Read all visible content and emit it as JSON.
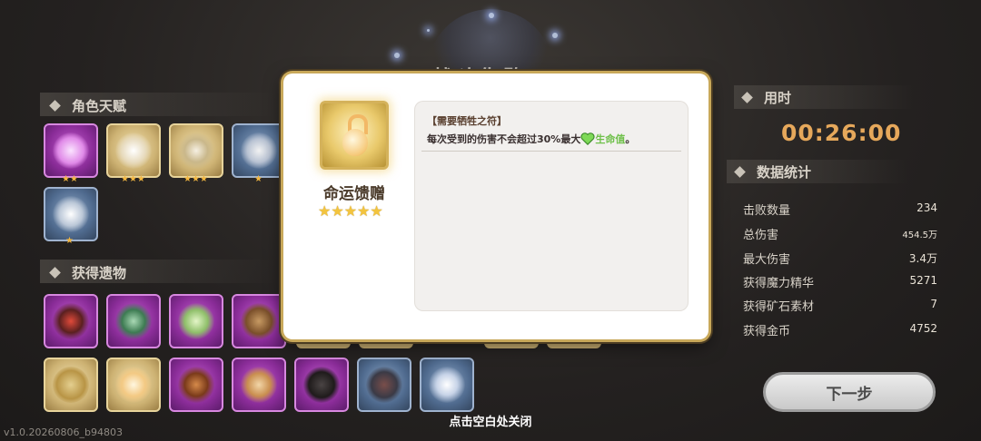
{
  "background_title": "战斗失败",
  "talents": {
    "title": "角色天赋",
    "tiles": [
      {
        "color": "purple",
        "icon": "flame-wing-icon",
        "stars": "★★"
      },
      {
        "color": "gold",
        "icon": "crescent-blade-icon",
        "stars": "★★★"
      },
      {
        "color": "gold",
        "icon": "cross-blades-icon",
        "stars": "★★★"
      },
      {
        "color": "blue",
        "icon": "bubble-beast-icon",
        "stars": "★"
      },
      {
        "color": "blue",
        "icon": "wind-slash-icon",
        "stars": "★"
      }
    ]
  },
  "relics": {
    "title": "获得遗物",
    "row1": [
      {
        "color": "purple",
        "icon": "horned-helmet-icon"
      },
      {
        "color": "purple",
        "icon": "green-hat-icon"
      },
      {
        "color": "purple",
        "icon": "cabbage-icon"
      },
      {
        "color": "purple",
        "icon": "coconut-icon"
      }
    ],
    "row2": [
      {
        "color": "gold",
        "icon": "gold-shield-icon"
      },
      {
        "color": "gold",
        "icon": "gourd-icon"
      },
      {
        "color": "purple",
        "icon": "chain-whip-icon"
      },
      {
        "color": "purple",
        "icon": "bread-icon"
      },
      {
        "color": "purple",
        "icon": "coal-icon"
      },
      {
        "color": "blue",
        "icon": "rune-stone-icon"
      },
      {
        "color": "blue",
        "icon": "feather-blades-icon"
      }
    ]
  },
  "popup": {
    "item_name": "命运馈赠",
    "item_stars": "★★★★★",
    "tag": "【需要牺牲之符】",
    "desc_prefix": "每次受到的伤害不会超过30%最大",
    "desc_hp": "生命值",
    "desc_suffix": "。"
  },
  "time": {
    "label": "用时",
    "value": "00:26:00"
  },
  "stats": {
    "title": "数据统计",
    "rows": [
      {
        "label": "击败数量",
        "value": "234"
      },
      {
        "label": "总伤害",
        "value": "454.5万"
      },
      {
        "label": "最大伤害",
        "value": "3.4万"
      },
      {
        "label": "获得魔力精华",
        "value": "5271"
      },
      {
        "label": "获得矿石素材",
        "value": "7"
      },
      {
        "label": "获得金币",
        "value": "4752"
      }
    ]
  },
  "next_button": "下一步",
  "close_hint": "点击空白处关闭",
  "version": "v1.0.20260806_b94803"
}
